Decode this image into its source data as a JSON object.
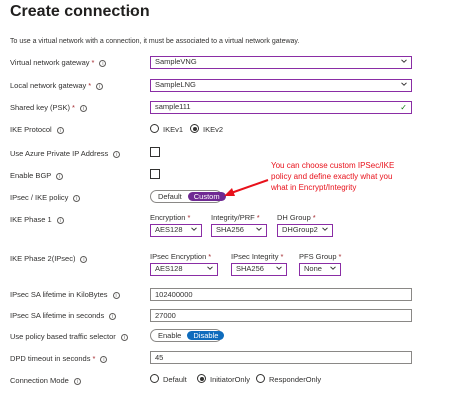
{
  "header": {
    "title": "Create connection",
    "more": "···"
  },
  "intro": "To use a virtual network with a connection, it must be associated to a virtual network gateway.",
  "fields": {
    "vng": {
      "label": "Virtual network gateway",
      "value": "SampleVNG"
    },
    "lng": {
      "label": "Local network gateway",
      "value": "SampleLNG"
    },
    "psk": {
      "label": "Shared key (PSK)",
      "value": "sample111"
    },
    "ike_protocol": {
      "label": "IKE Protocol",
      "options": [
        "IKEv1",
        "IKEv2"
      ],
      "selected": "IKEv2"
    },
    "private_ip": {
      "label": "Use Azure Private IP Address"
    },
    "bgp": {
      "label": "Enable BGP"
    },
    "policy": {
      "label": "IPsec / IKE policy",
      "options": [
        "Default",
        "Custom"
      ],
      "selected": "Custom"
    },
    "ike_phase1": {
      "label": "IKE Phase 1",
      "encryption": {
        "label": "Encryption",
        "value": "AES128"
      },
      "integrity": {
        "label": "Integrity/PRF",
        "value": "SHA256"
      },
      "dh_group": {
        "label": "DH Group",
        "value": "DHGroup2"
      }
    },
    "ike_phase2": {
      "label": "IKE Phase 2(IPsec)",
      "encryption": {
        "label": "IPsec Encryption",
        "value": "AES128"
      },
      "integrity": {
        "label": "IPsec Integrity",
        "value": "SHA256"
      },
      "pfs": {
        "label": "PFS Group",
        "value": "None"
      }
    },
    "sa_kb": {
      "label": "IPsec SA lifetime in KiloBytes",
      "value": "102400000"
    },
    "sa_sec": {
      "label": "IPsec SA lifetime in seconds",
      "value": "27000"
    },
    "ts_selector": {
      "label": "Use policy based traffic selector",
      "options": [
        "Enable",
        "Disable"
      ],
      "selected": "Disable"
    },
    "dpd": {
      "label": "DPD timeout in seconds",
      "value": "45"
    },
    "conn_mode": {
      "label": "Connection Mode",
      "options": [
        "Default",
        "InitiatorOnly",
        "ResponderOnly"
      ],
      "selected": "InitiatorOnly"
    }
  },
  "annotation": {
    "lines": [
      "You can choose custom IPSec/IKE",
      "policy and define exactly what you",
      "what in Encrypt/Integrity"
    ],
    "color": "#e8111b"
  },
  "colors": {
    "accent": "#8a2da5",
    "selected_toggle": "#6f2a93",
    "blue_toggle": "#0f6cbd",
    "valid": "#107c10",
    "required": "#a4262c"
  }
}
